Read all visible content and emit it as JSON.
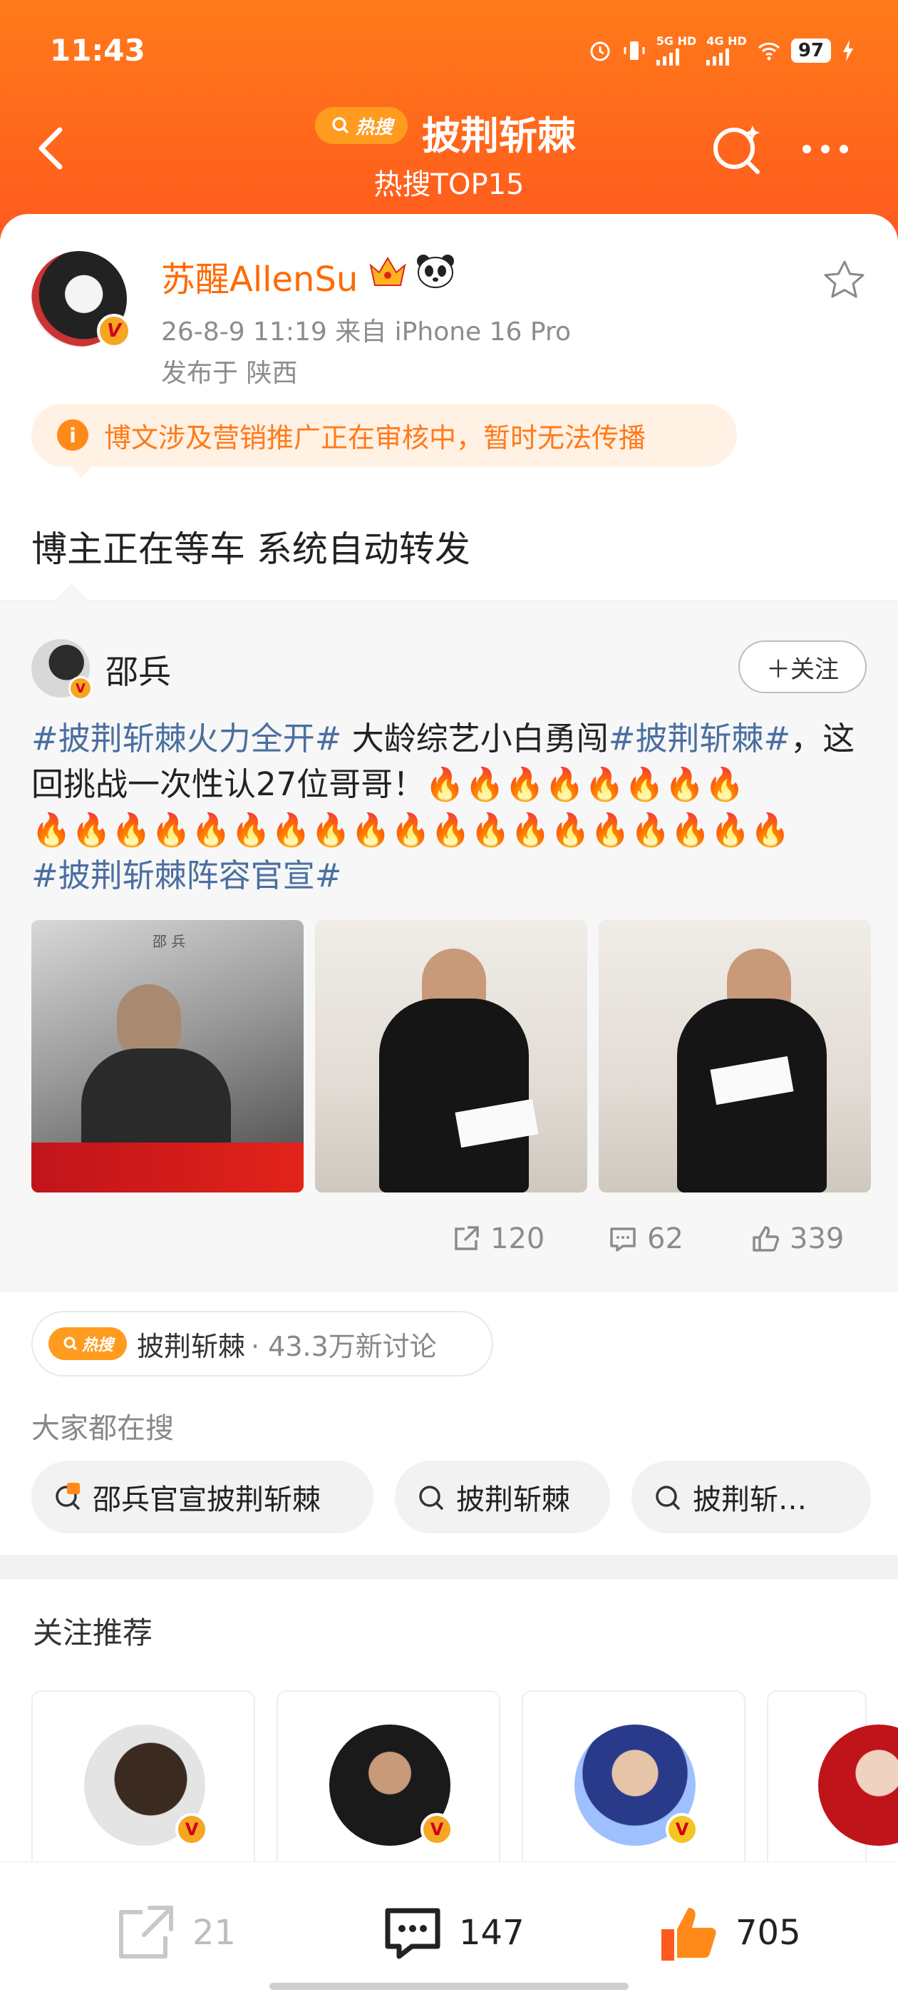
{
  "status_bar": {
    "time": "11:43",
    "net1": "5G HD",
    "net2": "4G HD",
    "battery": "97"
  },
  "header": {
    "hot_label": "热搜",
    "title": "披荆斩棘",
    "subtitle": "热搜TOP15"
  },
  "post": {
    "author": "苏醒AllenSu",
    "verified_badge": "V",
    "time_source": "26-8-9 11:19   来自 iPhone 16 Pro",
    "location": "发布于 陕西",
    "notice": "博文涉及营销推广正在审核中，暂时无法传播",
    "text": "博主正在等车 系统自动转发"
  },
  "repost": {
    "author": "邵兵",
    "follow_label": "＋关注",
    "tag1": "#披荆斩棘火力全开#",
    "text1": " 大龄综艺小白勇闯",
    "tag2": "#披荆斩棘#",
    "text2": "，这回挑战一次性认27位哥哥！",
    "fire_line1": "🔥🔥🔥🔥🔥🔥🔥🔥",
    "fire_line2": "🔥🔥🔥🔥🔥🔥🔥🔥🔥🔥🔥🔥🔥🔥🔥🔥🔥🔥🔥",
    "tag3": "#披荆斩棘阵容官宣#",
    "photo1_caption": "邵 兵",
    "repost_count": "120",
    "comment_count": "62",
    "like_count": "339"
  },
  "hot_topic": {
    "label": "热搜",
    "name": "披荆斩棘",
    "stat": "· 43.3万新讨论"
  },
  "also_search": {
    "title": "大家都在搜",
    "items": [
      "邵兵官宣披荆斩棘",
      "披荆斩棘",
      "披荆斩…"
    ]
  },
  "recommend": {
    "title": "关注推荐"
  },
  "bottom_bar": {
    "repost_count": "21",
    "comment_count": "147",
    "like_count": "705"
  },
  "colors": {
    "brand_orange": "#ff6a00",
    "header_gradient_top": "#ff7a1a",
    "tag_blue": "#4a6fa1",
    "notice_bg": "#fff1e3"
  }
}
